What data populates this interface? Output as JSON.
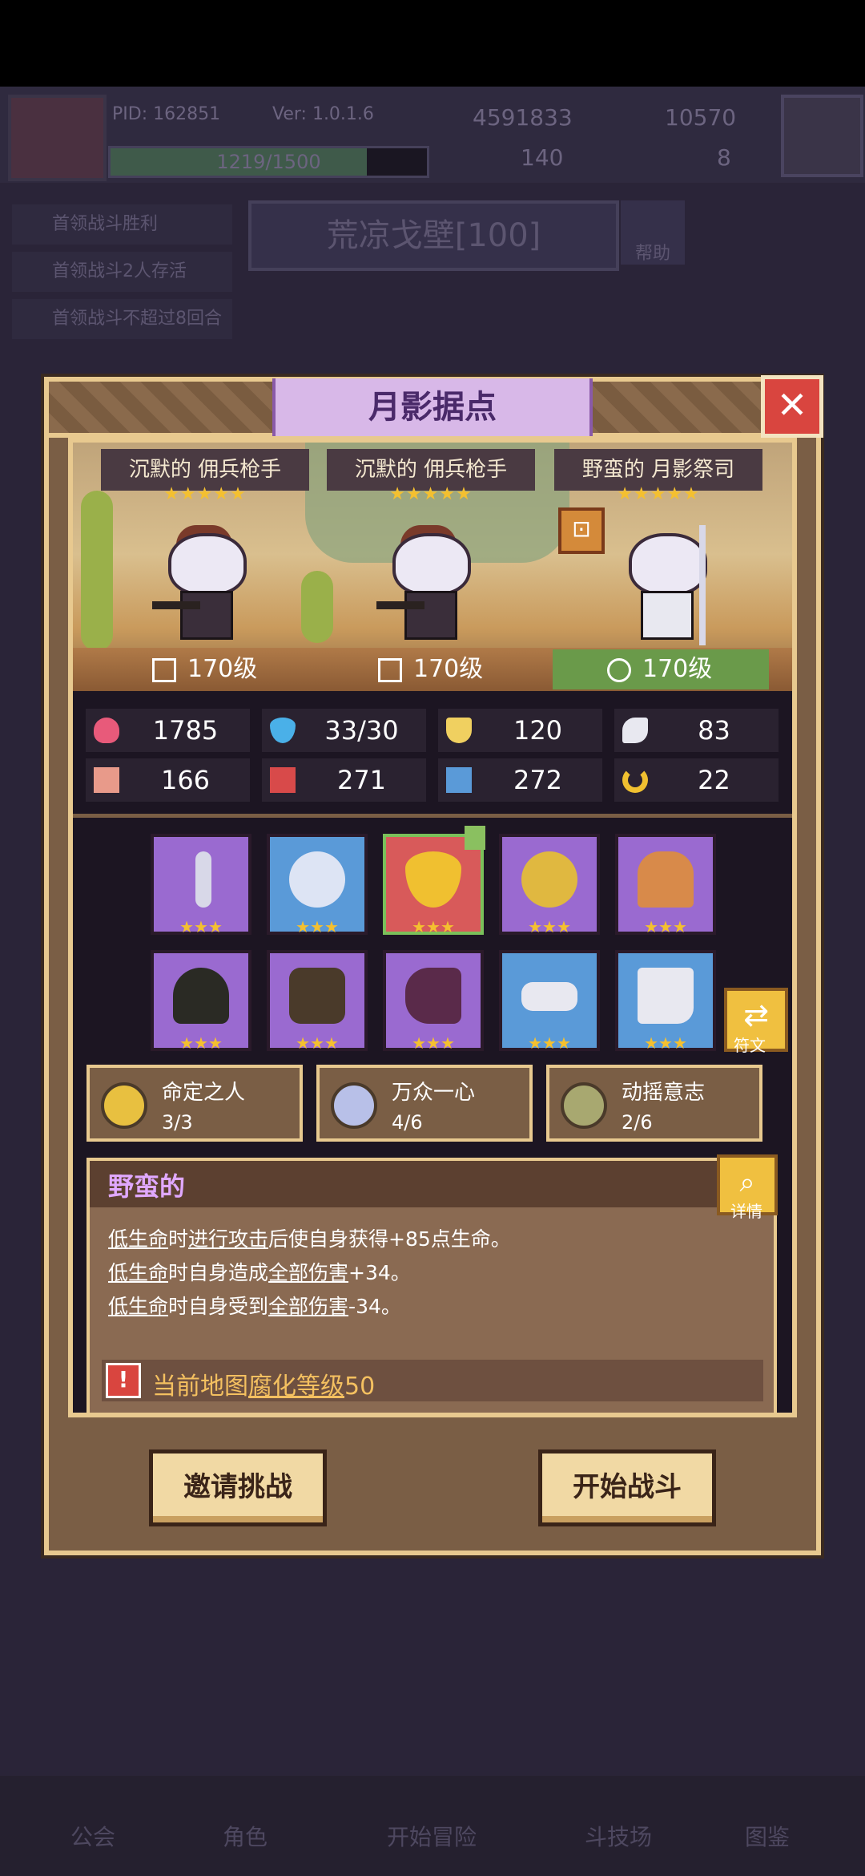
{
  "background": {
    "pid": "PID: 162851",
    "version": "Ver: 1.0.1.6",
    "currency_gold": "4591833",
    "currency_gem": "10570",
    "currency_clover": "140",
    "currency_key": "8",
    "energy": "1219/1500",
    "energy_fraction": 0.81,
    "quests": [
      "首领战斗胜利",
      "首领战斗2人存活",
      "首领战斗不超过8回合"
    ],
    "map_title": "荒凉戈壁[100]",
    "help_label": "帮助",
    "nav": [
      "公会",
      "角色",
      "开始冒险",
      "斗技场",
      "图鉴"
    ]
  },
  "dialog": {
    "title": "月影据点",
    "heroes": [
      {
        "name": "沉默的 佣兵枪手",
        "stars": "★★★★★",
        "level": "170级"
      },
      {
        "name": "沉默的 佣兵枪手",
        "stars": "★★★★★",
        "level": "170级"
      },
      {
        "name": "野蛮的 月影祭司",
        "stars": "★★★★★",
        "level": "170级"
      }
    ],
    "stats": [
      {
        "icon": "heart-icon",
        "value": "1785",
        "color": "#e85a7a"
      },
      {
        "icon": "mana-drop-icon",
        "value": "33/30",
        "color": "#4ab0e8"
      },
      {
        "icon": "shield-icon",
        "value": "120",
        "color": "#f0d060"
      },
      {
        "icon": "wing-icon",
        "value": "83",
        "color": "#e8e8f0"
      },
      {
        "icon": "fist-icon",
        "value": "166",
        "color": "#e89a8a"
      },
      {
        "icon": "spellbook-icon",
        "value": "271",
        "color": "#d84a4a"
      },
      {
        "icon": "scroll-icon",
        "value": "272",
        "color": "#5a9ad8"
      },
      {
        "icon": "horseshoe-icon",
        "value": "22",
        "color": "#f0c030"
      }
    ],
    "equipment": [
      {
        "name": "staff-icon",
        "rarity": "purple",
        "stars": "★★★"
      },
      {
        "name": "crystal-orb-icon",
        "rarity": "blue",
        "stars": "★★★"
      },
      {
        "name": "amulet-icon",
        "rarity": "red",
        "stars": "★★★"
      },
      {
        "name": "gold-medallion-icon",
        "rarity": "purple",
        "stars": "★★★"
      },
      {
        "name": "crown-icon",
        "rarity": "purple",
        "stars": "★★★"
      },
      {
        "name": "hood-icon",
        "rarity": "purple",
        "stars": "★★★"
      },
      {
        "name": "armor-icon",
        "rarity": "purple",
        "stars": "★★★"
      },
      {
        "name": "glove-icon",
        "rarity": "purple",
        "stars": "★★★"
      },
      {
        "name": "belt-icon",
        "rarity": "blue",
        "stars": "★★★"
      },
      {
        "name": "boots-icon",
        "rarity": "blue",
        "stars": "★★★"
      }
    ],
    "rune_label": "符文",
    "sets": [
      {
        "name": "命定之人",
        "count": "3/3",
        "color": "#e8c040"
      },
      {
        "name": "万众一心",
        "count": "4/6",
        "color": "#b8c0e8"
      },
      {
        "name": "动摇意志",
        "count": "2/6",
        "color": "#a8a870"
      }
    ],
    "trait": {
      "title": "野蛮的",
      "lines": [
        {
          "a": "低生命",
          "b": "时",
          "c": "进行攻击",
          "d": "后使自身获得+85点生命。"
        },
        {
          "a": "低生命",
          "b": "时自身造成",
          "c": "全部伤害",
          "d": "+34。"
        },
        {
          "a": "低生命",
          "b": "时自身受到",
          "c": "全部伤害",
          "d": "-34。"
        }
      ],
      "detail_label": "详情",
      "warning_pre": "当前地图",
      "warning_u": "腐化等级",
      "warning_post": "50"
    },
    "buttons": {
      "invite": "邀请挑战",
      "start": "开始战斗"
    }
  }
}
